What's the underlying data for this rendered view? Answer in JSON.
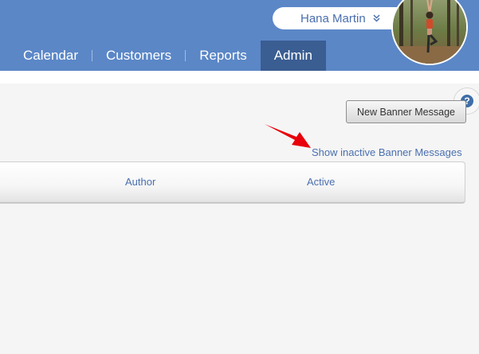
{
  "header": {
    "user_name": "Hana Martin",
    "nav": [
      {
        "label": "Calendar",
        "active": false
      },
      {
        "label": "Customers",
        "active": false
      },
      {
        "label": "Reports",
        "active": false
      },
      {
        "label": "Admin",
        "active": true
      }
    ]
  },
  "toolbar": {
    "new_button_label": "New Banner Message",
    "inactive_link": "Show inactive Banner Messages",
    "help_label": "?"
  },
  "table": {
    "columns": [
      "Author",
      "Active"
    ]
  },
  "icons": {
    "user_menu": "chevron-double-down-icon",
    "help": "help-icon",
    "annotation": "red-arrow-icon"
  },
  "colors": {
    "header_bg": "#5b87c7",
    "active_tab_bg": "#3a5d92",
    "link": "#4a6fae",
    "arrow": "#e8000b"
  }
}
